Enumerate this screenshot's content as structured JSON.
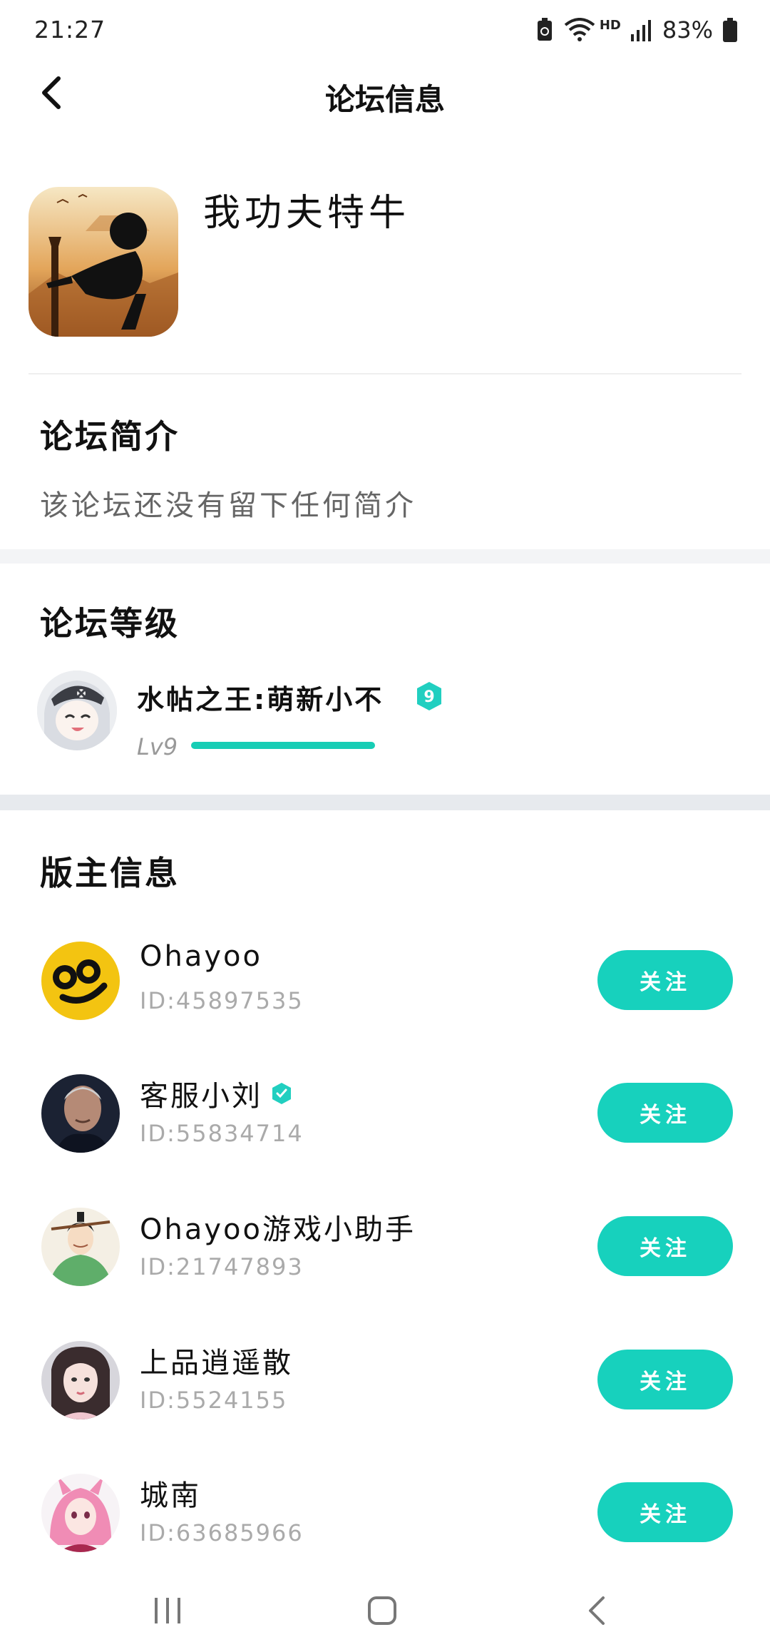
{
  "status_bar": {
    "time": "21:27",
    "network_label": "HD",
    "battery_percent": "83%"
  },
  "header": {
    "title": "论坛信息"
  },
  "forum": {
    "name": "我功夫特牛"
  },
  "intro": {
    "title": "论坛简介",
    "text": "该论坛还没有留下任何简介"
  },
  "level": {
    "title": "论坛等级",
    "name": "水帖之王:萌新小不",
    "badge": "9",
    "lv_label": "Lv9",
    "progress": 1.0,
    "accent_color": "#17cdb5"
  },
  "moderators": {
    "title": "版主信息",
    "follow_label": "关注",
    "items": [
      {
        "name": "Ohayoo",
        "id": "ID:45897535",
        "verified": false,
        "avatar": "yellow-face"
      },
      {
        "name": "客服小刘",
        "id": "ID:55834714",
        "verified": true,
        "avatar": "man-portrait"
      },
      {
        "name": "Ohayoo游戏小助手",
        "id": "ID:21747893",
        "verified": false,
        "avatar": "swordsman"
      },
      {
        "name": "上品逍遥散",
        "id": "ID:5524155",
        "verified": false,
        "avatar": "girl-portrait"
      },
      {
        "name": "城南",
        "id": "ID:63685966",
        "verified": false,
        "avatar": "pink-hair-girl"
      }
    ]
  },
  "colors": {
    "accent": "#17d1bd",
    "band": "#e7eaee"
  }
}
